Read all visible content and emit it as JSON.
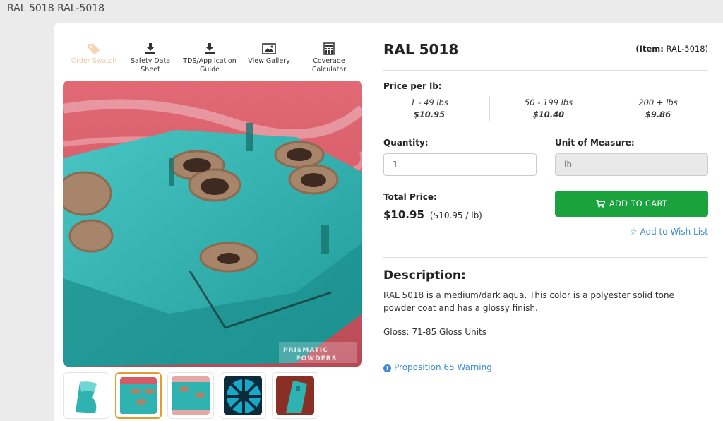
{
  "page": {
    "title": "RAL 5018 RAL-5018"
  },
  "tools": [
    {
      "label": "Order Swatch",
      "icon": "tag-icon",
      "disabled": true
    },
    {
      "label": "Safety Data Sheet",
      "icon": "download-icon"
    },
    {
      "label": "TDS/Application Guide",
      "icon": "download-icon"
    },
    {
      "label": "View Gallery",
      "icon": "image-icon"
    },
    {
      "label": "Coverage Calculator",
      "icon": "calculator-icon"
    }
  ],
  "product": {
    "title": "RAL 5018",
    "item_label": "(Item:",
    "item_code": "RAL-5018)",
    "watermark": "PRISMATIC POWDERS"
  },
  "pricing": {
    "label": "Price per lb:",
    "tiers": [
      {
        "range": "1 - 49 lbs",
        "price": "$10.95"
      },
      {
        "range": "50 - 199 lbs",
        "price": "$10.40"
      },
      {
        "range": "200 + lbs",
        "price": "$9.86"
      }
    ]
  },
  "order": {
    "quantity_label": "Quantity:",
    "quantity_value": "1",
    "uom_label": "Unit of Measure:",
    "uom_value": "lb",
    "total_label": "Total Price:",
    "total_value": "$10.95",
    "total_per": "($10.95 / lb)",
    "cart_button": "ADD TO CART",
    "wishlist": "Add to Wish List"
  },
  "description": {
    "heading": "Description:",
    "body": "RAL 5018 is a medium/dark aqua. This color is a polyester solid tone powder coat and has a glossy finish.",
    "gloss": "Gloss: 71-85 Gloss Units",
    "prop65": "Proposition 65 Warning"
  },
  "colors": {
    "accent_green": "#1aa23d",
    "link_blue": "#3b8ad6",
    "aqua": "#2fb3b0",
    "thumb_active": "#e89a2c"
  }
}
